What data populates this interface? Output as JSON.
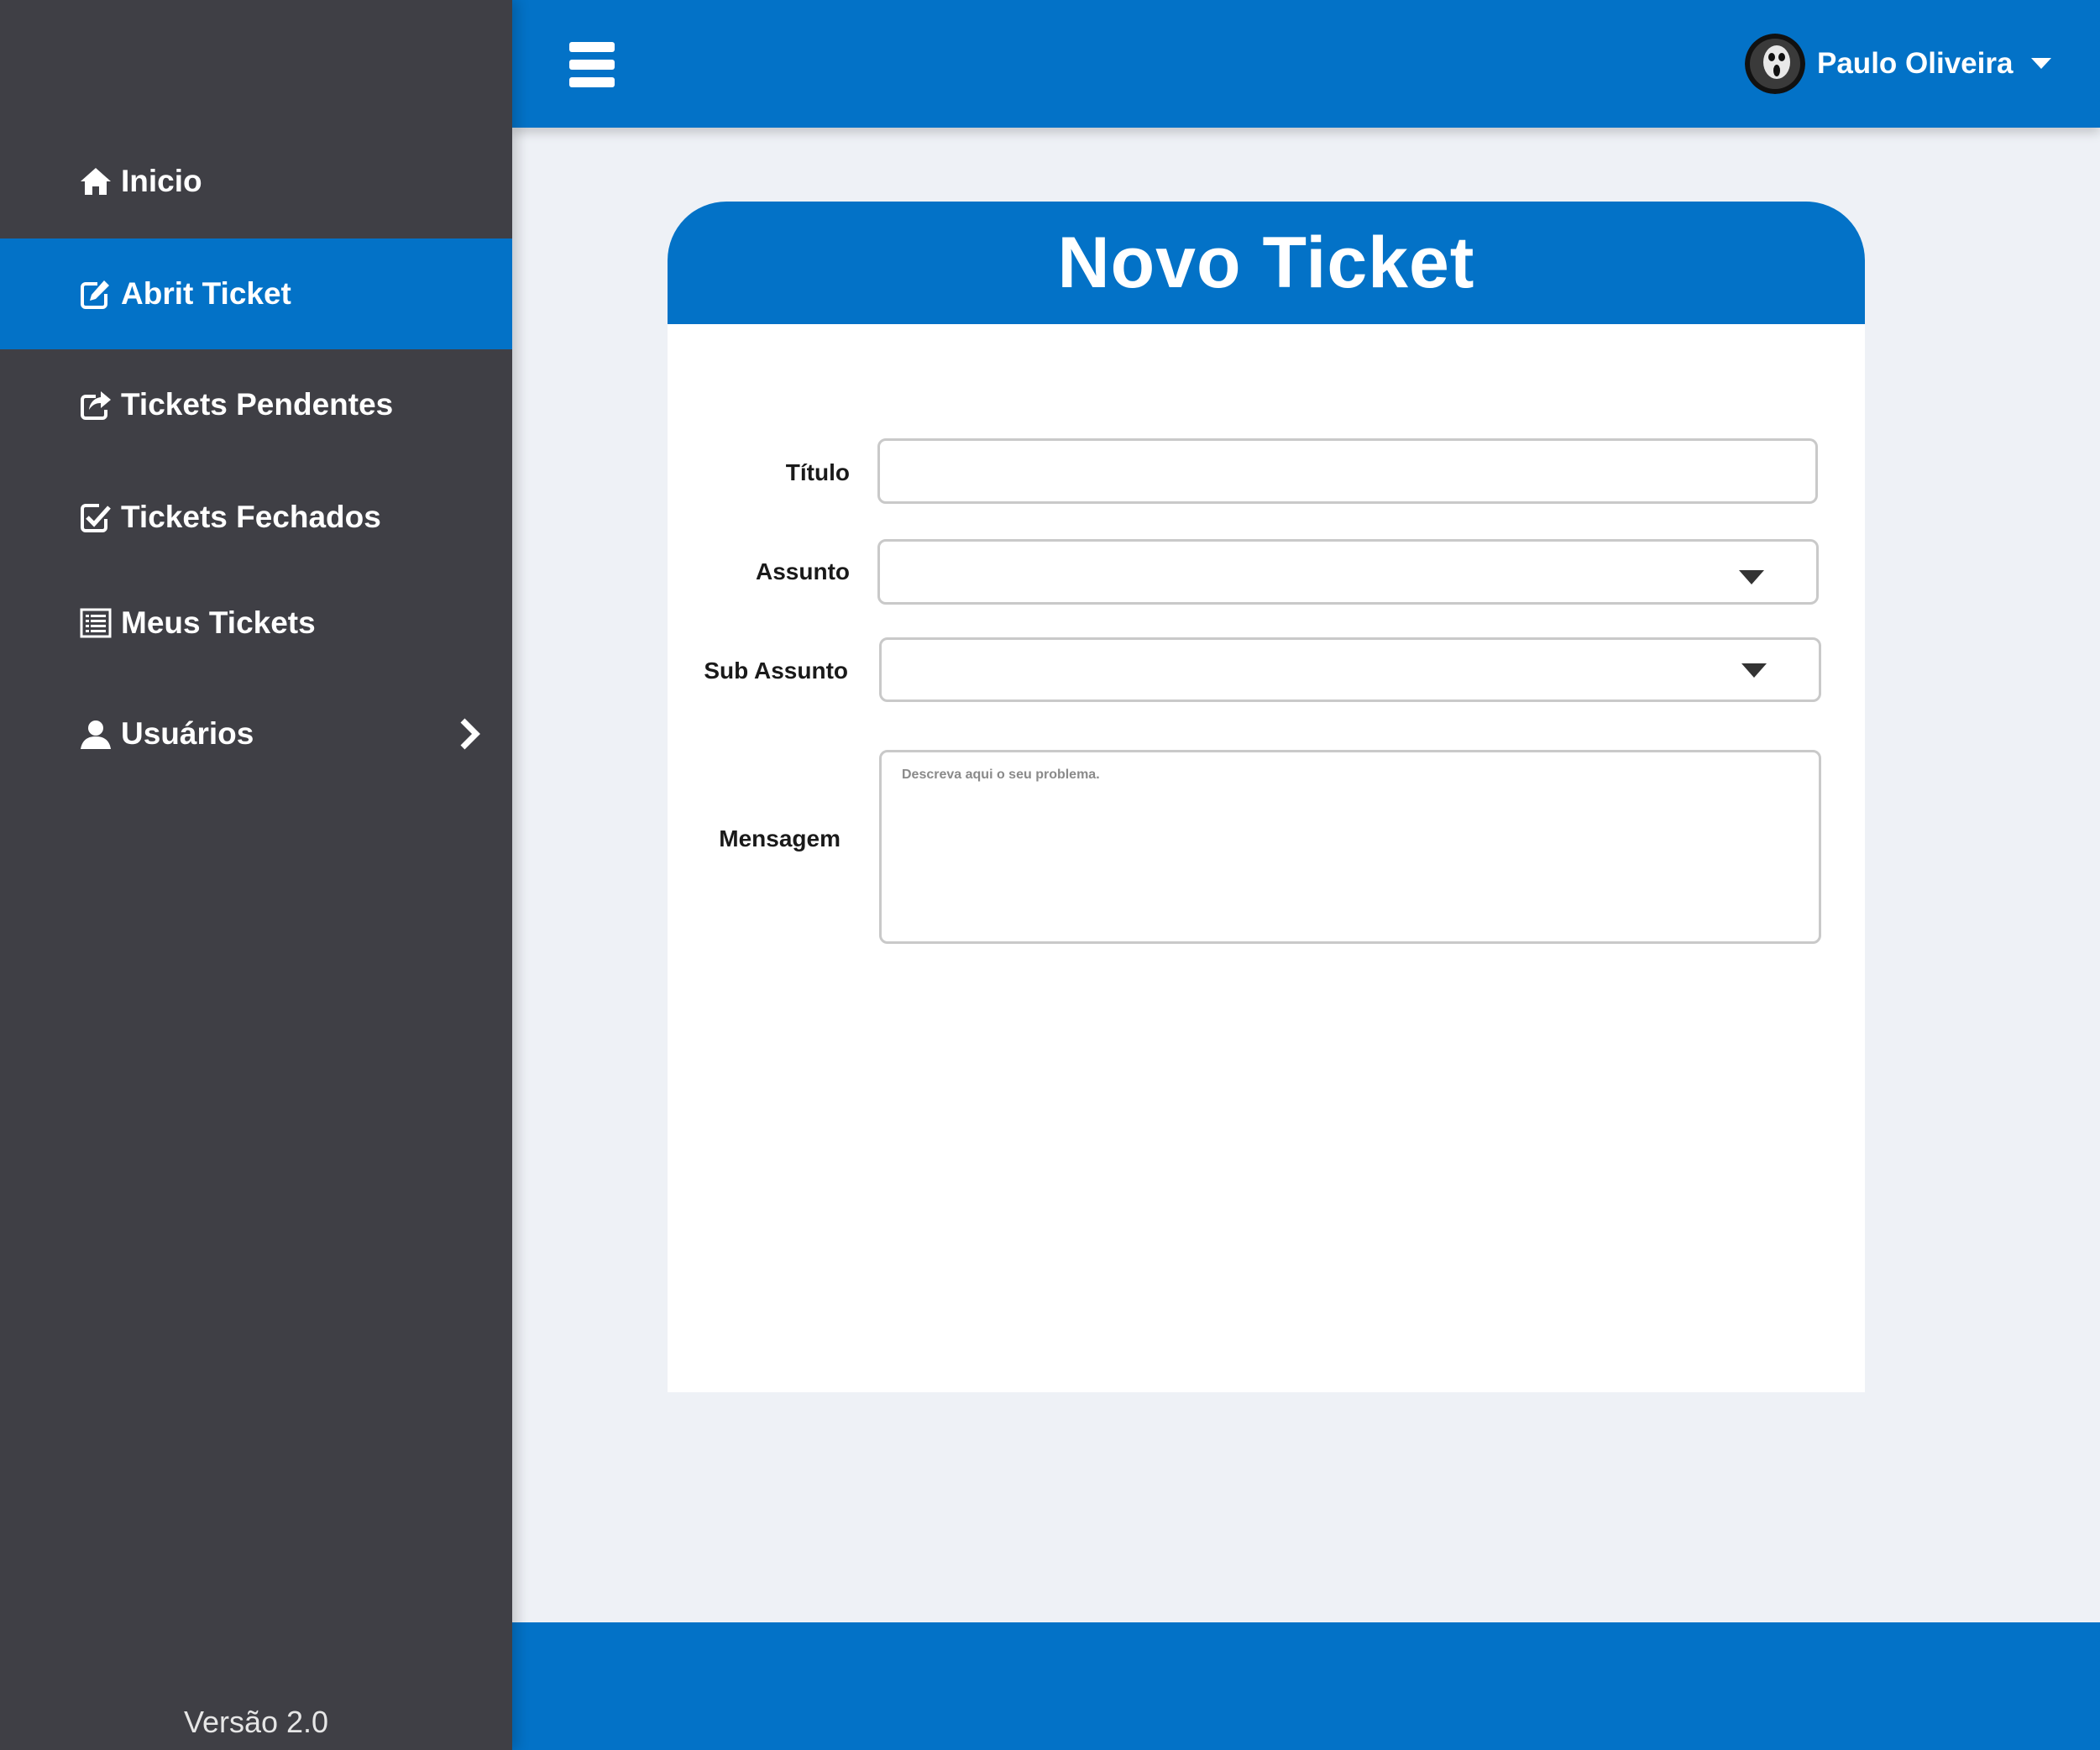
{
  "sidebar": {
    "items": [
      {
        "label": "Inicio",
        "icon": "home-icon"
      },
      {
        "label": "Abrit Ticket",
        "icon": "edit-icon",
        "active": true
      },
      {
        "label": "Tickets Pendentes",
        "icon": "share-icon"
      },
      {
        "label": "Tickets Fechados",
        "icon": "check-square-icon"
      },
      {
        "label": "Meus Tickets",
        "icon": "list-icon"
      },
      {
        "label": "Usuários",
        "icon": "user-icon",
        "has_submenu": true
      }
    ],
    "version": "Versão 2.0"
  },
  "header": {
    "menu_icon": "hamburger-icon",
    "user_name": "Paulo Oliveira",
    "user_menu_icon": "caret-down-icon"
  },
  "form": {
    "title": "Novo Ticket",
    "fields": {
      "titulo": {
        "label": "Título",
        "value": ""
      },
      "assunto": {
        "label": "Assunto",
        "value": ""
      },
      "sub_assunto": {
        "label": "Sub Assunto",
        "value": ""
      },
      "mensagem": {
        "label": "Mensagem",
        "value": "",
        "placeholder": "Descreva aqui o seu problema."
      }
    }
  },
  "colors": {
    "primary": "#0372c7",
    "sidebar_bg": "#3f3f45",
    "page_bg": "#eef1f6"
  }
}
